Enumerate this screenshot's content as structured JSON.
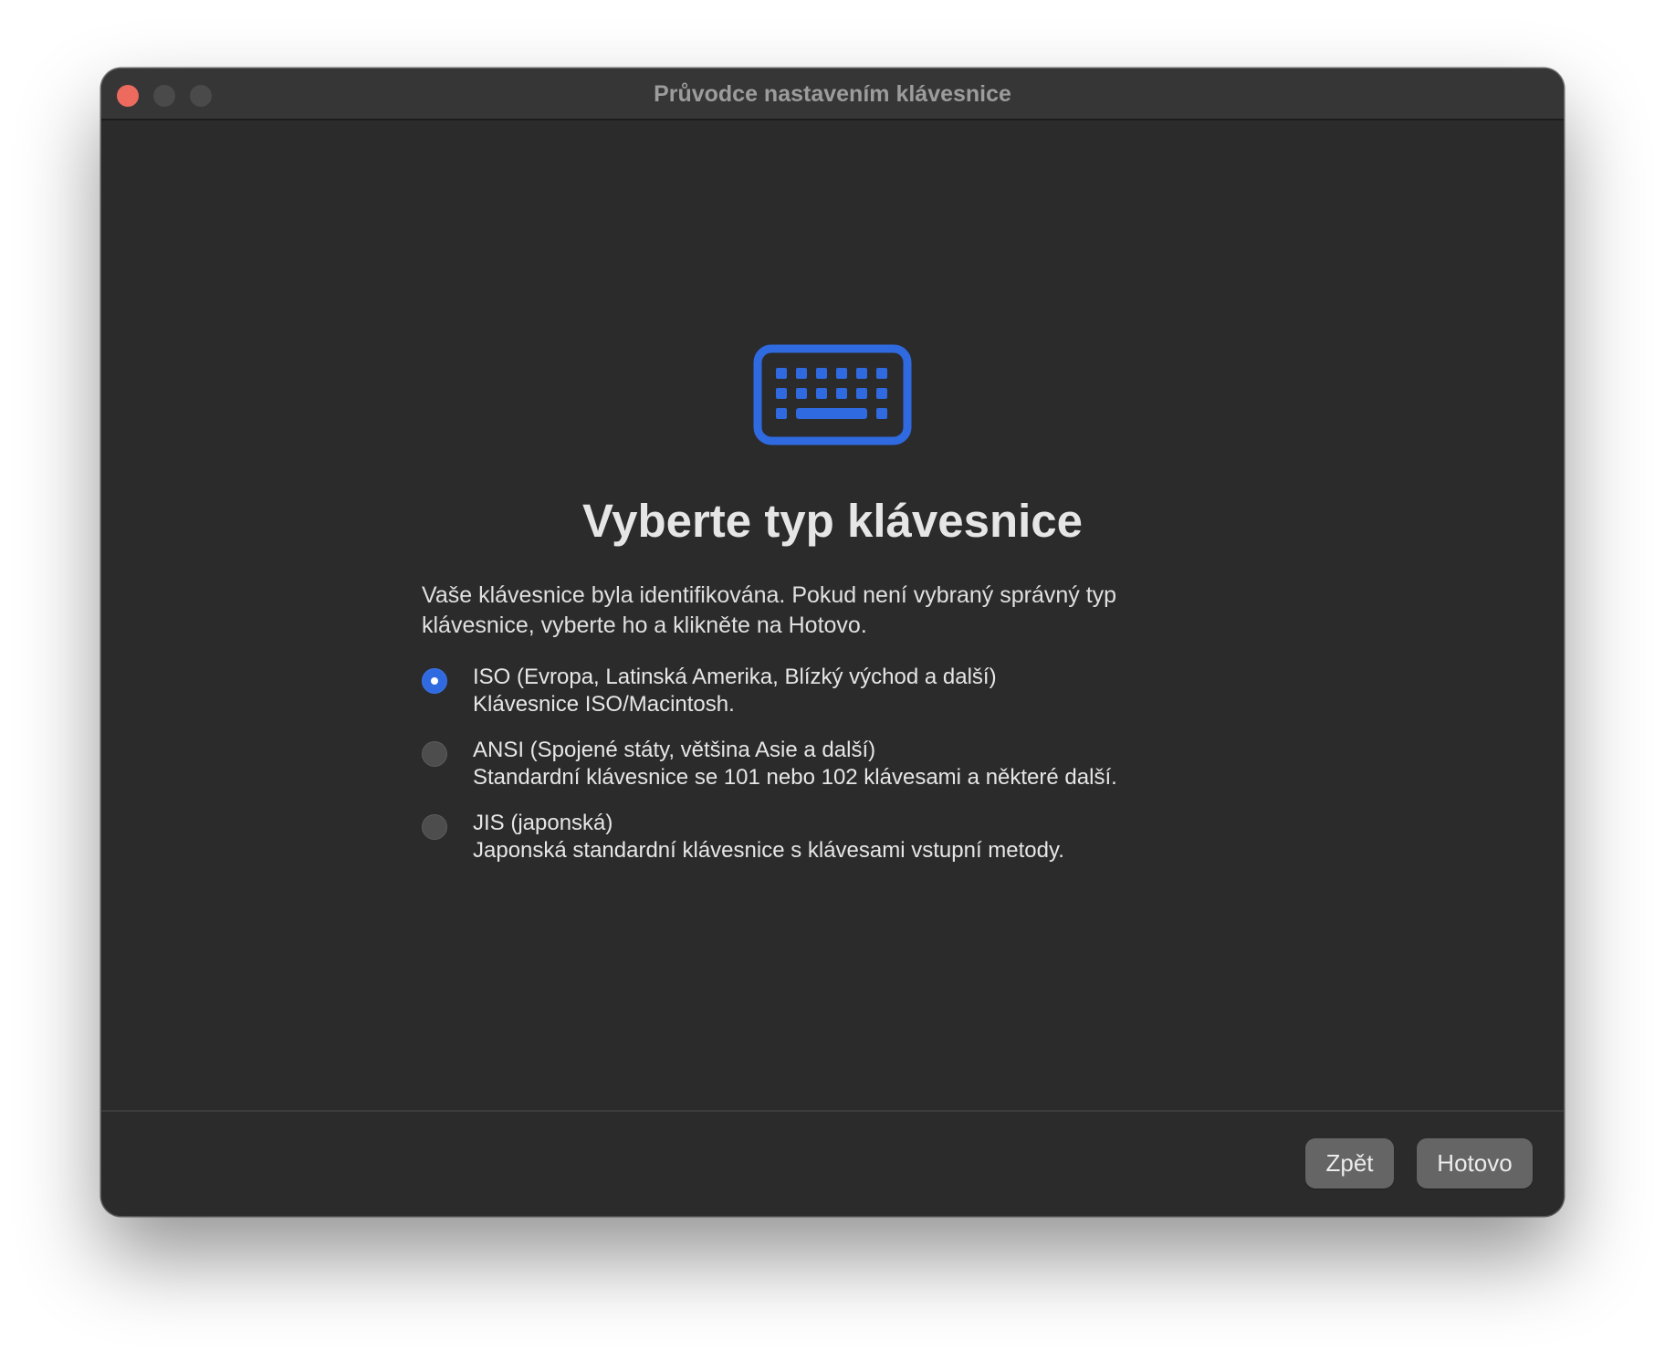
{
  "window": {
    "title": "Průvodce nastavením klávesnice"
  },
  "main": {
    "icon": "keyboard-icon",
    "accent_color": "#2f6ae0",
    "heading": "Vyberte typ klávesnice",
    "description": "Vaše klávesnice byla identifikována. Pokud není vybraný správný typ klávesnice, vyberte ho a klikněte na Hotovo.",
    "options": [
      {
        "title": "ISO (Evropa, Latinská Amerika, Blízký východ a další)",
        "description": "Klávesnice ISO/Macintosh.",
        "selected": true
      },
      {
        "title": "ANSI (Spojené státy, většina Asie a další)",
        "description": "Standardní klávesnice se 101 nebo 102 klávesami a některé další.",
        "selected": false
      },
      {
        "title": "JIS (japonská)",
        "description": "Japonská standardní klávesnice s klávesami vstupní metody.",
        "selected": false
      }
    ]
  },
  "footer": {
    "back_label": "Zpět",
    "done_label": "Hotovo"
  }
}
